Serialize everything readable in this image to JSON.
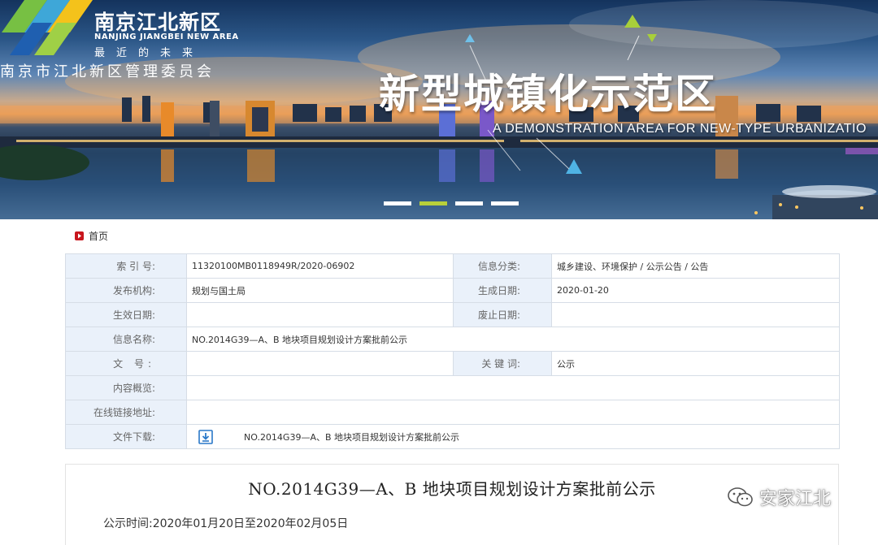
{
  "banner": {
    "logo_cn": "南京江北新区",
    "logo_en": "NANJING JIANGBEI NEW AREA",
    "logo_slogan": "最近的未来",
    "committee": "南京市江北新区管理委员会",
    "slogan_cn": "新型城镇化示范区",
    "slogan_en": "A DEMONSTRATION AREA FOR NEW-TYPE URBANIZATIO",
    "slides": 4,
    "active_slide": 2
  },
  "breadcrumb": {
    "home": "首页",
    "icon": "home-arrow-icon",
    "accent": "#c8161d"
  },
  "info": {
    "index_label": "索 引 号:",
    "index_value": "11320100MB0118949R/2020-06902",
    "category_label": "信息分类:",
    "category_value": "城乡建设、环境保护 / 公示公告 / 公告",
    "publisher_label": "发布机构:",
    "publisher_value": "规划与国土局",
    "created_label": "生成日期:",
    "created_value": "2020-01-20",
    "effective_label": "生效日期:",
    "effective_value": "",
    "expiry_label": "废止日期:",
    "expiry_value": "",
    "name_label": "信息名称:",
    "name_value": "NO.2014G39—A、B 地块项目规划设计方案批前公示",
    "docno_label": "文 号:",
    "docno_value": "",
    "keyword_label": "关 键 词:",
    "keyword_value": "公示",
    "summary_label": "内容概览:",
    "summary_value": "",
    "link_label": "在线链接地址:",
    "link_value": "",
    "download_label": "文件下载:",
    "download_value": "NO.2014G39—A、B 地块项目规划设计方案批前公示",
    "download_icon": "download-icon"
  },
  "article": {
    "title": "NO.2014G39—A、B 地块项目规划设计方案批前公示",
    "date_line": "公示时间:2020年01月20日至2020年02月05日"
  },
  "watermark": {
    "text": "安家江北",
    "icon": "wechat-icon"
  },
  "colors": {
    "label_bg": "#eaf1fa",
    "border": "#d6dde6",
    "download_icon": "#2a78c8",
    "active_dot": "#b8d03a"
  }
}
